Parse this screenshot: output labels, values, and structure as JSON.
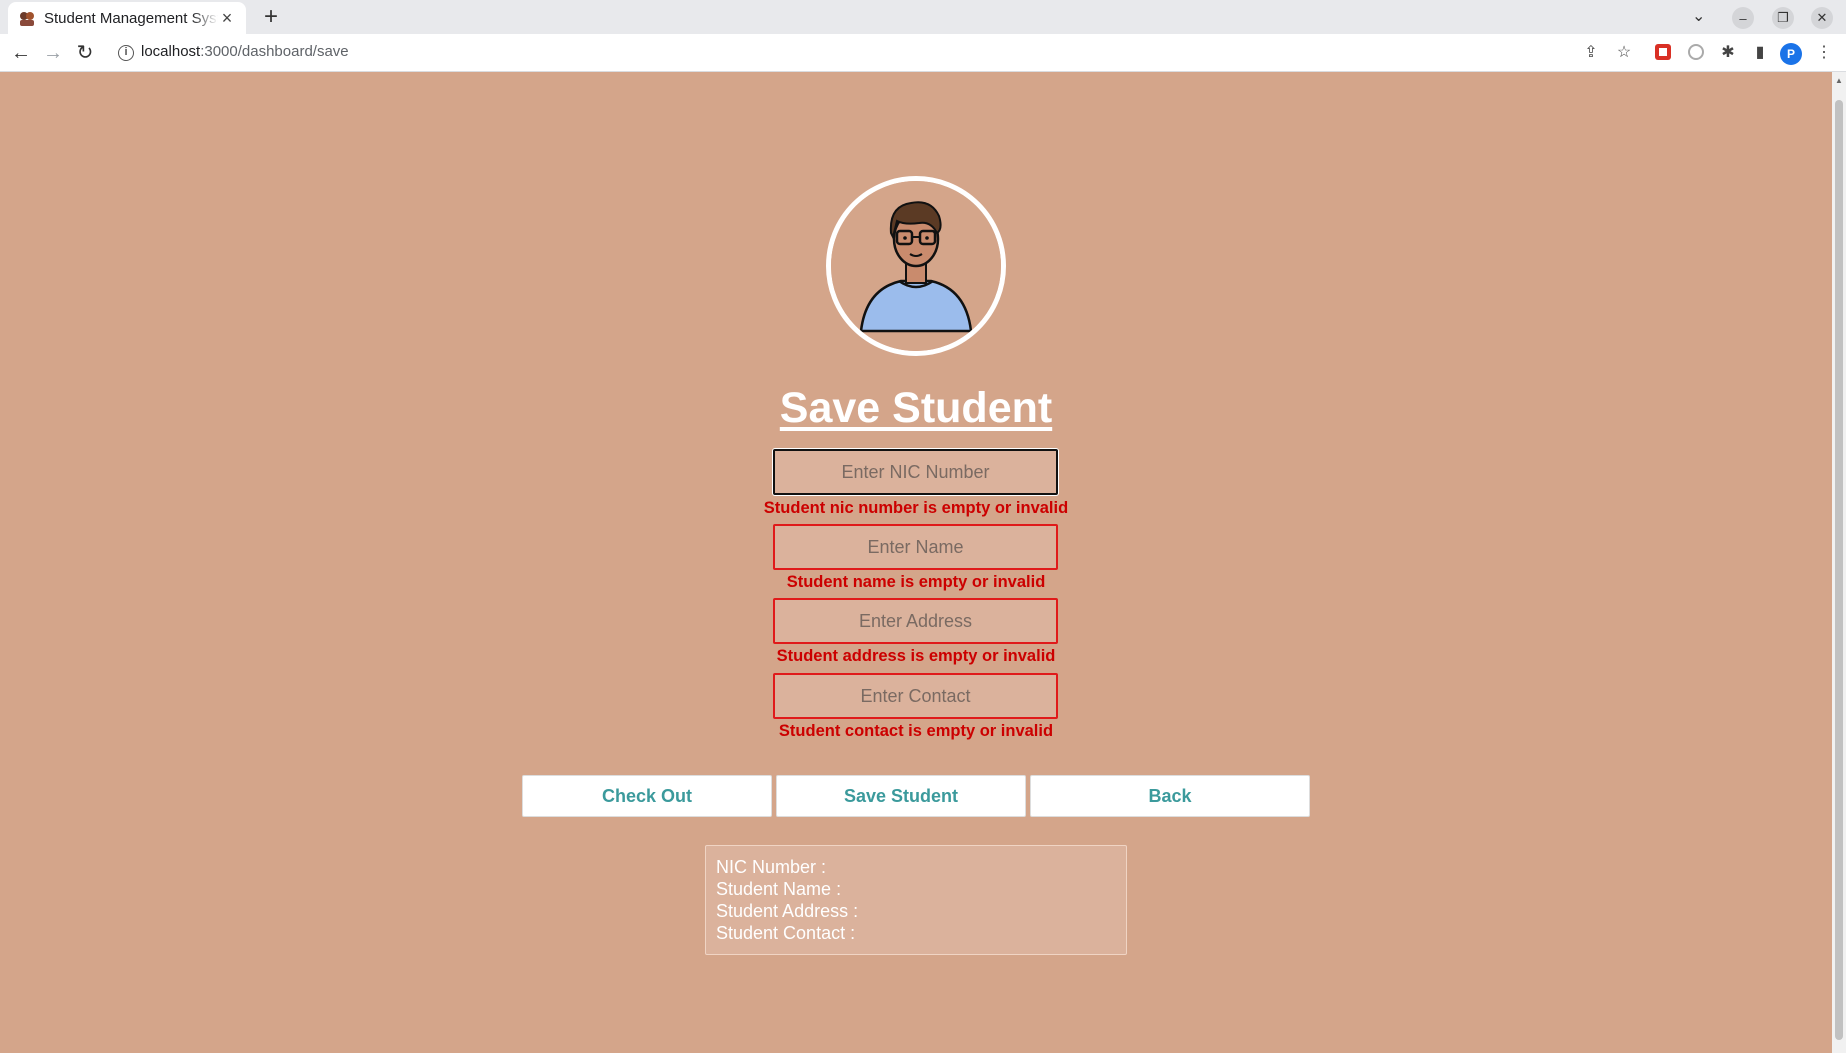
{
  "browser": {
    "tab_title": "Student Management System",
    "new_tab_label": "+",
    "url_host": "localhost",
    "url_path": ":3000/dashboard/save",
    "profile_initial": "P"
  },
  "page": {
    "title": "Save Student",
    "fields": {
      "nic": {
        "placeholder": "Enter NIC Number",
        "value": "",
        "error": "Student nic number is empty or invalid"
      },
      "name": {
        "placeholder": "Enter Name",
        "value": "",
        "error": "Student name is empty or invalid"
      },
      "address": {
        "placeholder": "Enter Address",
        "value": "",
        "error": "Student address is empty or invalid"
      },
      "contact": {
        "placeholder": "Enter Contact",
        "value": "",
        "error": "Student contact is empty or invalid"
      }
    },
    "buttons": {
      "checkout": "Check Out",
      "save": "Save Student",
      "back": "Back"
    },
    "summary": {
      "nic_label": "NIC Number :",
      "name_label": "Student Name :",
      "address_label": "Student Address :",
      "contact_label": "Student Contact :"
    }
  },
  "colors": {
    "page_background": "#d4a58a",
    "error_text": "#cc0000",
    "button_text": "#3b9a9c",
    "field_background": "#dbb29c"
  },
  "icons": [
    "student-avatar",
    "back-arrow-icon",
    "forward-arrow-icon",
    "reload-icon",
    "share-icon",
    "star-icon",
    "extensions-icon",
    "side-panel-icon",
    "menu-icon"
  ]
}
